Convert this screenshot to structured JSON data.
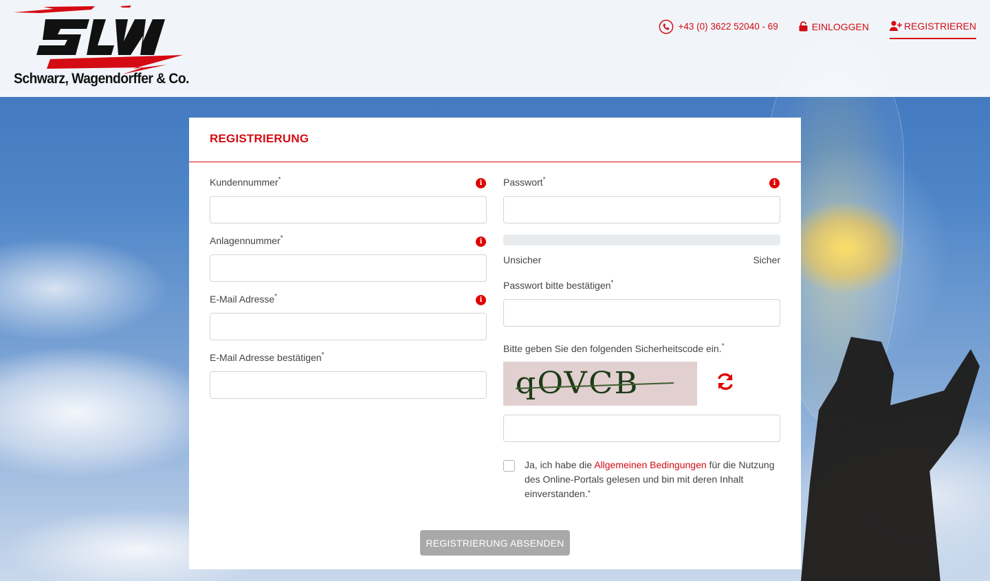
{
  "brand": {
    "logo_monogram": "SLW",
    "company_name": "Schwarz, Wagendorffer & Co.",
    "accent_color": "#d40b12"
  },
  "nav": {
    "phone": "+43 (0) 3622 52040 - 69",
    "login": "EINLOGGEN",
    "register": "REGISTRIEREN"
  },
  "form": {
    "title": "REGISTRIERUNG",
    "left": {
      "customer_number_label": "Kundennummer",
      "system_number_label": "Anlagennummer",
      "email_label": "E-Mail Adresse",
      "email_confirm_label": "E-Mail Adresse bestätigen"
    },
    "right": {
      "password_label": "Passwort",
      "strength_low": "Unsicher",
      "strength_high": "Sicher",
      "password_confirm_label": "Passwort bitte bestätigen",
      "captcha_label": "Bitte geben Sie den folgenden Sicherheitscode ein.",
      "captcha_code": "qOVCB"
    },
    "required_mark": "*",
    "terms_prefix": "Ja, ich habe die ",
    "terms_link": "Allgemeinen Bedingungen",
    "terms_suffix": " für die Nutzung des Online-Portals gelesen und bin mit deren Inhalt einverstanden.",
    "submit_label": "REGISTRIERUNG ABSENDEN"
  },
  "icons": {
    "phone": "phone-icon",
    "lock": "lock-icon",
    "user_plus": "user-plus-icon",
    "info": "info-icon",
    "refresh": "refresh-icon"
  }
}
